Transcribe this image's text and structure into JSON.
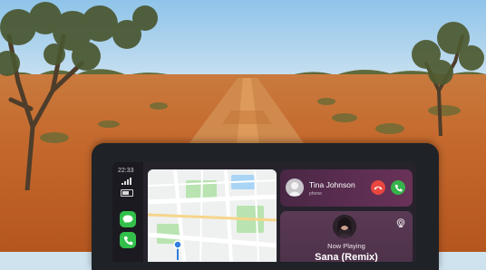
{
  "status_bar": {
    "time": "22:33"
  },
  "call": {
    "caller_name": "Tina Johnson",
    "caller_detail": "phone"
  },
  "music": {
    "header": "Now Playing",
    "title": "Sana (Remix)"
  },
  "icons": {
    "signal": "signal-bars-icon",
    "battery": "battery-icon",
    "messages": "messages-app-icon",
    "phone": "phone-app-icon",
    "decline": "decline-call-icon",
    "accept": "accept-call-icon",
    "airplay": "airplay-icon",
    "location": "location-pin-icon"
  },
  "colors": {
    "decline": "#e8463f",
    "accept": "#36b24a",
    "app_green": "#32c04a",
    "call_card": "#5d2e52",
    "music_card": "#533650"
  }
}
